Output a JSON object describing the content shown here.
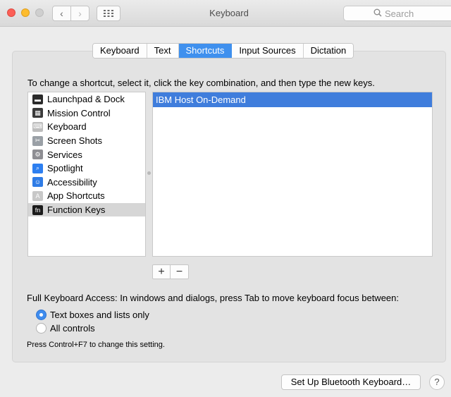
{
  "window": {
    "title": "Keyboard",
    "search_placeholder": "Search",
    "back_glyph": "‹",
    "forward_glyph": "›",
    "icons": {
      "back": "chevron-left-icon",
      "forward": "chevron-right-icon",
      "grid": "grid-icon",
      "search": "search-icon"
    }
  },
  "tabs": [
    {
      "label": "Keyboard",
      "active": false
    },
    {
      "label": "Text",
      "active": false
    },
    {
      "label": "Shortcuts",
      "active": true
    },
    {
      "label": "Input Sources",
      "active": false
    },
    {
      "label": "Dictation",
      "active": false
    }
  ],
  "shortcuts": {
    "instructions": "To change a shortcut, select it, click the key combination, and then type the new keys.",
    "categories": [
      {
        "label": "Launchpad & Dock",
        "icon": "launchpad-icon",
        "color": "#2b2b2b",
        "glyph": "▬",
        "selected": false
      },
      {
        "label": "Mission Control",
        "icon": "mission-control-icon",
        "color": "#3a3a3a",
        "glyph": "▦",
        "selected": false
      },
      {
        "label": "Keyboard",
        "icon": "keyboard-icon",
        "color": "#bdbdbd",
        "glyph": "⌨",
        "selected": false
      },
      {
        "label": "Screen Shots",
        "icon": "screenshot-icon",
        "color": "#9aa0a6",
        "glyph": "✂",
        "selected": false
      },
      {
        "label": "Services",
        "icon": "gear-icon",
        "color": "#8e8e93",
        "glyph": "⚙",
        "selected": false
      },
      {
        "label": "Spotlight",
        "icon": "spotlight-icon",
        "color": "#2d7ff0",
        "glyph": "⌕",
        "selected": false
      },
      {
        "label": "Accessibility",
        "icon": "accessibility-icon",
        "color": "#2f7ce6",
        "glyph": "☺",
        "selected": false
      },
      {
        "label": "App Shortcuts",
        "icon": "app-shortcuts-icon",
        "color": "#c8c8c8",
        "glyph": "A",
        "selected": false
      },
      {
        "label": "Function Keys",
        "icon": "fn-key-icon",
        "color": "#1c1c1c",
        "glyph": "fn",
        "selected": true
      }
    ],
    "items": [
      {
        "label": "IBM Host On-Demand",
        "selected": true
      }
    ],
    "add_label": "+",
    "remove_label": "−"
  },
  "keyboard_access": {
    "label": "Full Keyboard Access: In windows and dialogs, press Tab to move keyboard focus between:",
    "options": [
      {
        "label": "Text boxes and lists only",
        "checked": true
      },
      {
        "label": "All controls",
        "checked": false
      }
    ],
    "hint": "Press Control+F7 to change this setting."
  },
  "footer": {
    "bluetooth_button": "Set Up Bluetooth Keyboard…",
    "help_label": "?"
  },
  "colors": {
    "accent": "#3f90ee",
    "selection": "#3f7ddc",
    "close": "#fc5f57",
    "minimize": "#fdbc2e"
  }
}
